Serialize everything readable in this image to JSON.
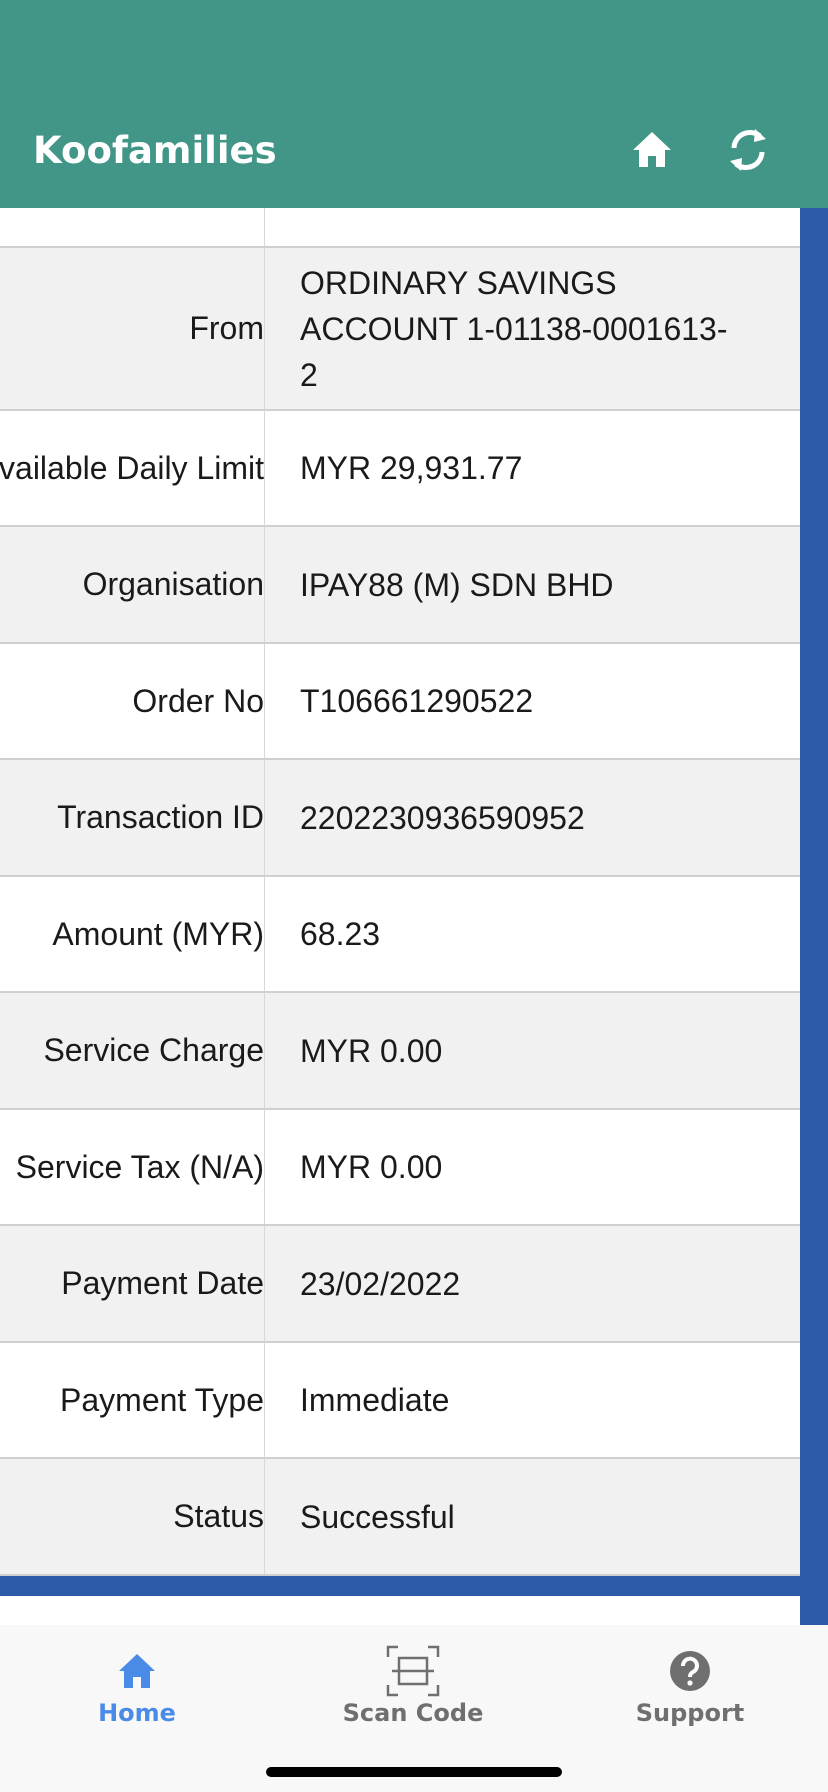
{
  "header": {
    "title": "Koofamilies",
    "home_icon": "home-icon",
    "refresh_icon": "refresh-icon",
    "bg_color": "#429688"
  },
  "table": {
    "rows": [
      {
        "label": "",
        "value": ""
      },
      {
        "label": "From",
        "value": "ORDINARY SAVINGS ACCOUNT 1-01138-0001613-2"
      },
      {
        "label": "Available Daily Limit",
        "value": "MYR 29,931.77"
      },
      {
        "label": "Organisation",
        "value": "IPAY88 (M) SDN BHD"
      },
      {
        "label": "Order No",
        "value": "T106661290522"
      },
      {
        "label": "Transaction ID",
        "value": "2202230936590952"
      },
      {
        "label": "Amount (MYR)",
        "value": "68.23"
      },
      {
        "label": "Service Charge",
        "value": "MYR 0.00"
      },
      {
        "label": "Service Tax (N/A)",
        "value": "MYR 0.00"
      },
      {
        "label": "Payment Date",
        "value": "23/02/2022"
      },
      {
        "label": "Payment Type",
        "value": "Immediate"
      },
      {
        "label": "Status",
        "value": "Successful"
      }
    ]
  },
  "tabbar": {
    "home_label": "Home",
    "scan_label": "Scan Code",
    "support_label": "Support",
    "active_color": "#4a8be8",
    "inactive_color": "#6f6f6f"
  },
  "accent_blue": "#2c5aa9"
}
